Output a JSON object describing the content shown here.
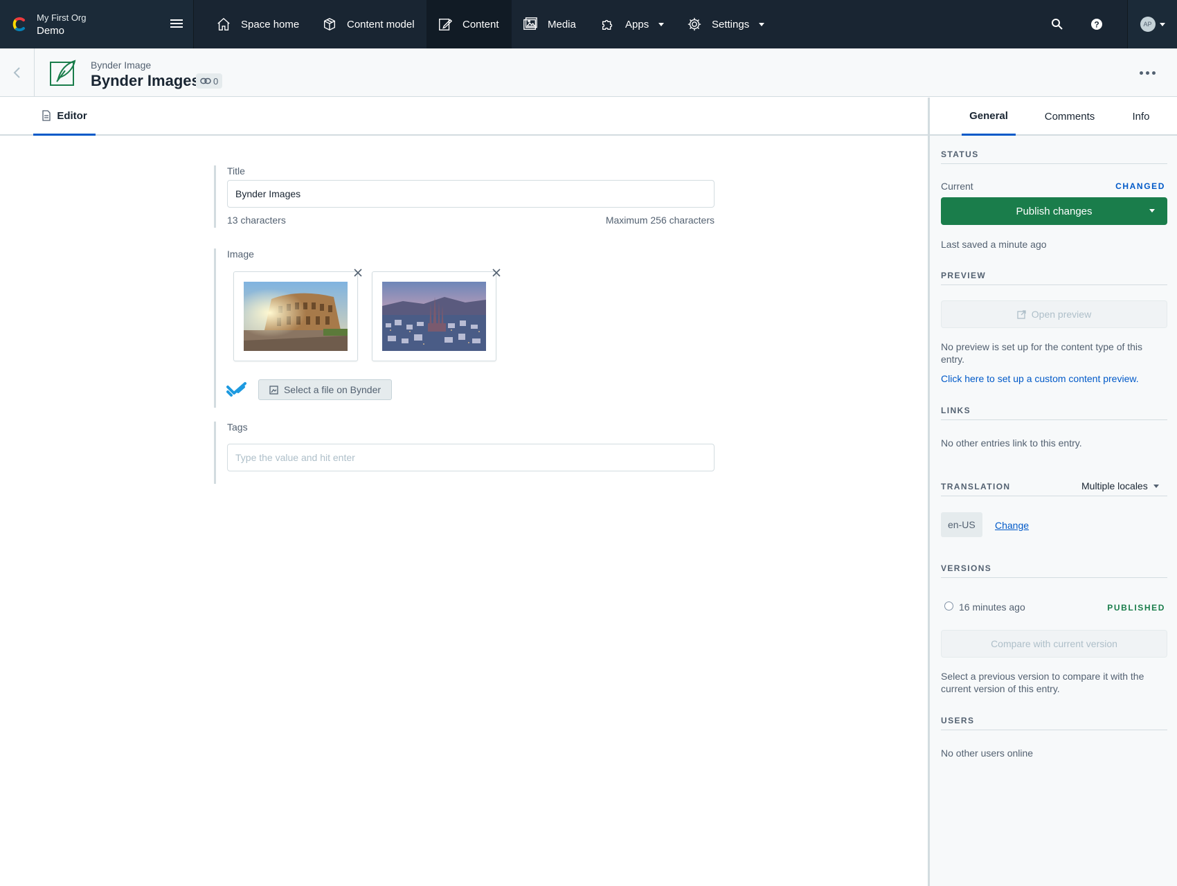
{
  "org": {
    "name": "My First Org",
    "space": "Demo"
  },
  "nav": {
    "items": [
      {
        "label": "Space home"
      },
      {
        "label": "Content model"
      },
      {
        "label": "Content"
      },
      {
        "label": "Media"
      },
      {
        "label": "Apps"
      },
      {
        "label": "Settings"
      }
    ],
    "avatar_initials": "AP"
  },
  "entry": {
    "content_type": "Bynder Image",
    "title": "Bynder Images",
    "references": "0"
  },
  "editor_tab": "Editor",
  "fields": {
    "title": {
      "label": "Title",
      "value": "Bynder Images",
      "char_count": "13 characters",
      "max": "Maximum 256 characters"
    },
    "image": {
      "label": "Image",
      "button": "Select a file on Bynder"
    },
    "tags": {
      "label": "Tags",
      "placeholder": "Type the value and hit enter"
    }
  },
  "sidebar": {
    "tabs": [
      "General",
      "Comments",
      "Info"
    ],
    "status": {
      "heading": "STATUS",
      "current_label": "Current",
      "current_value": "CHANGED",
      "publish_button": "Publish changes",
      "last_saved": "Last saved a minute ago"
    },
    "preview": {
      "heading": "PREVIEW",
      "button": "Open preview",
      "note": "No preview is set up for the content type of this entry.",
      "link": "Click here to set up a custom content preview."
    },
    "links": {
      "heading": "LINKS",
      "text": "No other entries link to this entry."
    },
    "translation": {
      "heading": "TRANSLATION",
      "mode": "Multiple locales",
      "locale": "en-US",
      "change": "Change"
    },
    "versions": {
      "heading": "VERSIONS",
      "entry_time": "16 minutes ago",
      "entry_status": "PUBLISHED",
      "compare_button": "Compare with current version",
      "note": "Select a previous version to compare it with the current version of this entry."
    },
    "users": {
      "heading": "USERS",
      "text": "No other users online"
    }
  },
  "colors": {
    "nav_bg": "#192532",
    "accent": "#0059c8",
    "publish_green": "#1a7d4b",
    "changed": "#0059c8",
    "published": "#1a7d4b"
  }
}
